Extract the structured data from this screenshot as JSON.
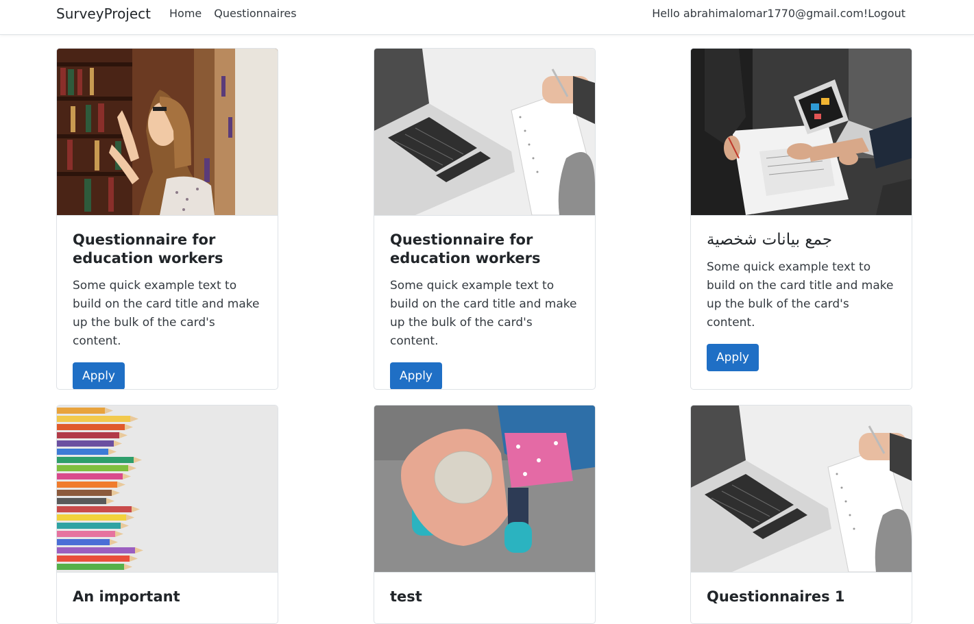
{
  "nav": {
    "brand": "SurveyProject",
    "links": [
      "Home",
      "Questionnaires"
    ],
    "greeting": "Hello abrahimalomar1770@gmail.com!",
    "logout": "Logout"
  },
  "colors": {
    "primary_button": "#1f6fc5",
    "border": "#dee2e6"
  },
  "cards": [
    {
      "image": "woman-in-library-photo",
      "title": "Questionnaire for education workers",
      "text": "Some quick example text to build on the card title and make up the bulk of the card's content.",
      "button": "Apply"
    },
    {
      "image": "laptop-and-notebook-photo",
      "title": "Questionnaire for education workers",
      "text": "Some quick example text to build on the card title and make up the bulk of the card's content.",
      "button": "Apply"
    },
    {
      "image": "team-meeting-laptop-photo",
      "title": "جمع بيانات شخصية",
      "text": "Some quick example text to build on the card title and make up the bulk of the card's content.",
      "button": "Apply"
    },
    {
      "image": "colored-pencils-photo",
      "title": "An important"
    },
    {
      "image": "cooperative-stone-photo",
      "title": "test"
    },
    {
      "image": "laptop-and-notebook-photo",
      "title": "Questionnaires 1"
    }
  ]
}
